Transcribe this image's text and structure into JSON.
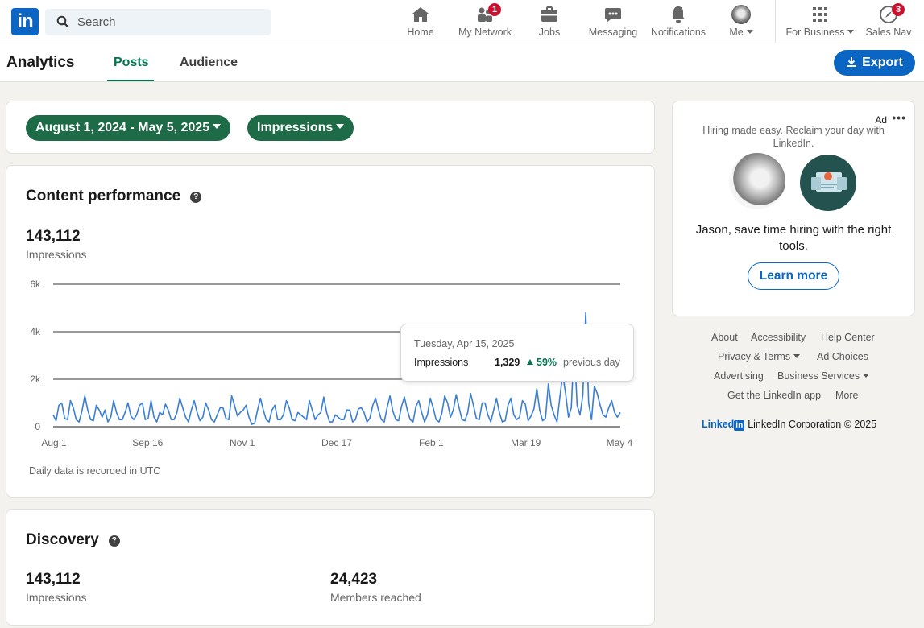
{
  "nav": {
    "logo": "in",
    "search_placeholder": "Search",
    "items": [
      {
        "label": "Home",
        "icon": "home-icon"
      },
      {
        "label": "My Network",
        "icon": "network-icon",
        "badge": "1"
      },
      {
        "label": "Jobs",
        "icon": "jobs-icon"
      },
      {
        "label": "Messaging",
        "icon": "messaging-icon"
      },
      {
        "label": "Notifications",
        "icon": "bell-icon"
      },
      {
        "label": "Me",
        "icon": "avatar"
      },
      {
        "label": "For Business",
        "icon": "grid-icon"
      },
      {
        "label": "Sales Nav",
        "icon": "compass-icon",
        "badge": "3"
      }
    ]
  },
  "subheader": {
    "title": "Analytics",
    "tabs": [
      "Posts",
      "Audience"
    ],
    "active_tab": "Posts",
    "export_label": "Export"
  },
  "filters": {
    "date_range": "August 1, 2024 - May 5, 2025",
    "metric": "Impressions"
  },
  "content_performance": {
    "title": "Content performance",
    "total": "143,112",
    "total_label": "Impressions",
    "footnote": "Daily data is recorded in UTC",
    "tooltip": {
      "date": "Tuesday, Apr 15, 2025",
      "label": "Impressions",
      "value": "1,329",
      "change": "59%",
      "change_suffix": "previous day"
    }
  },
  "chart_data": {
    "type": "line",
    "title": "",
    "xlabel": "",
    "ylabel": "",
    "x_tick_labels": [
      "Aug 1",
      "Sep 16",
      "Nov 1",
      "Dec 17",
      "Feb 1",
      "Mar 19",
      "May 4"
    ],
    "y_tick_labels": [
      "0",
      "2k",
      "4k",
      "6k"
    ],
    "ylim": [
      0,
      6000
    ],
    "grid": true,
    "line_color": "#3a7ed8",
    "series": [
      {
        "values": [
          500,
          250,
          900,
          1000,
          350,
          300,
          1100,
          800,
          300,
          200,
          650,
          1300,
          700,
          300,
          250,
          900,
          700,
          400,
          700,
          200,
          400,
          1100,
          600,
          300,
          300,
          600,
          1000,
          450,
          300,
          500,
          900,
          1000,
          300,
          350,
          1100,
          400,
          200,
          600,
          500,
          950,
          700,
          300,
          300,
          600,
          1200,
          800,
          400,
          200,
          700,
          1100,
          600,
          250,
          400,
          1000,
          700,
          300,
          200,
          500,
          800,
          800,
          350,
          300,
          1300,
          900,
          450,
          600,
          700,
          900,
          400,
          100,
          150,
          700,
          1200,
          700,
          300,
          200,
          700,
          900,
          300,
          300,
          500,
          1100,
          800,
          300,
          250,
          600,
          500,
          400,
          300,
          1100,
          700,
          300,
          500,
          600,
          1250,
          600,
          200,
          200,
          500,
          400,
          300,
          300,
          700,
          700,
          200,
          300,
          750,
          800,
          600,
          200,
          350,
          900,
          1200,
          700,
          300,
          200,
          800,
          1300,
          650,
          300,
          250,
          850,
          1250,
          700,
          300,
          200,
          850,
          1100,
          600,
          200,
          500,
          1200,
          800,
          300,
          200,
          550,
          1300,
          1000,
          400,
          700,
          1350,
          800,
          300,
          250,
          600,
          1400,
          900,
          350,
          300,
          1000,
          1000,
          500,
          200,
          700,
          1200,
          600,
          200,
          250,
          900,
          1200,
          500,
          300,
          400,
          1100,
          950,
          250,
          450,
          750,
          1600,
          700,
          250,
          350,
          1800,
          900,
          500,
          200,
          1250,
          2200,
          1400,
          400,
          800,
          3500,
          900,
          500,
          1329,
          4800,
          1000,
          300,
          1700,
          1400,
          900,
          500,
          400,
          800,
          1100,
          600,
          400,
          600
        ]
      }
    ]
  },
  "discovery": {
    "title": "Discovery",
    "impressions": "143,112",
    "impressions_label": "Impressions",
    "members": "24,423",
    "members_label": "Members reached"
  },
  "ad": {
    "label": "Ad",
    "tagline": "Hiring made easy. Reclaim your day with LinkedIn.",
    "pitch": "Jason, save time hiring with the right tools.",
    "cta": "Learn more"
  },
  "footer": {
    "links": [
      "About",
      "Accessibility",
      "Help Center",
      "Privacy & Terms",
      "Ad Choices",
      "Advertising",
      "Business Services",
      "Get the LinkedIn app",
      "More"
    ],
    "brand": "Linked",
    "brand_box": "in",
    "copyright": "LinkedIn Corporation © 2025"
  }
}
